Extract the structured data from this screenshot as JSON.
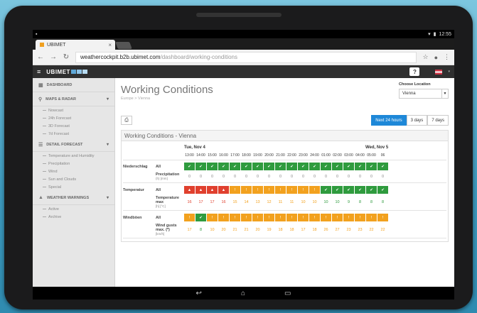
{
  "status_bar": {
    "left": "▪",
    "time": "12:55"
  },
  "browser": {
    "tab_title": "UBIMET",
    "url_host": "weathercockpit.b2b.ubimet.com",
    "url_path": "/dashboard/working-conditions"
  },
  "app": {
    "brand": "UBIMET",
    "help": "?"
  },
  "sidebar": {
    "dashboard": "DASHBOARD",
    "maps": "MAPS & RADAR",
    "maps_items": [
      "Nowcast",
      "24h Forecast",
      "3D Forecast",
      "7d Forecast"
    ],
    "detail": "DETAIL FORECAST",
    "detail_items": [
      "Temperature and Humidity",
      "Precipitation",
      "Wind",
      "Sun and Clouds",
      "Special"
    ],
    "warnings": "WEATHER WARNINGS",
    "warning_items": [
      "Active",
      "Archive"
    ]
  },
  "main": {
    "title": "Working Conditions",
    "breadcrumb": "Europe > Vienna",
    "location_label": "Choose Location",
    "location_value": "Vienna",
    "period_buttons": [
      "Next 24 hours",
      "3 days",
      "7 days"
    ],
    "panel_title": "Working Conditions - Vienna",
    "day1": "Tue, Nov 4",
    "day2": "Wed, Nov 5",
    "times": [
      "13:00",
      "14:00",
      "15:00",
      "16:00",
      "17:00",
      "18:00",
      "19:00",
      "20:00",
      "21:00",
      "22:00",
      "23:00",
      "24:00",
      "01:00",
      "02:00",
      "03:00",
      "04:00",
      "05:00",
      "06"
    ],
    "rows": [
      {
        "group": "Niederschlag",
        "sub": "All",
        "status": [
          "g",
          "g",
          "g",
          "g",
          "g",
          "g",
          "g",
          "g",
          "g",
          "g",
          "g",
          "g",
          "g",
          "g",
          "g",
          "g",
          "g",
          "g"
        ],
        "detail_label": "Precipitation",
        "detail_unit": "(h) [mm]",
        "values": [
          "0",
          "0",
          "0",
          "0",
          "0",
          "0",
          "0",
          "0",
          "0",
          "0",
          "0",
          "0",
          "0",
          "0",
          "0",
          "0",
          "0",
          "0"
        ]
      },
      {
        "group": "Temperatur",
        "sub": "All",
        "status": [
          "r",
          "r",
          "r",
          "r",
          "o",
          "o",
          "o",
          "o",
          "o",
          "o",
          "o",
          "o",
          "g",
          "g",
          "g",
          "g",
          "g",
          "g"
        ],
        "detail_label": "Temperature max",
        "detail_unit": "[h] [°C]",
        "values": [
          "16",
          "17",
          "17",
          "16",
          "15",
          "14",
          "13",
          "12",
          "11",
          "11",
          "10",
          "10",
          "10",
          "10",
          "9",
          "8",
          "8",
          "8"
        ]
      },
      {
        "group": "Windböen",
        "sub": "All",
        "status": [
          "o",
          "g",
          "o",
          "o",
          "o",
          "o",
          "o",
          "o",
          "o",
          "o",
          "o",
          "o",
          "o",
          "o",
          "o",
          "o",
          "o",
          "o"
        ],
        "detail_label": "Wind gusts max. (*)",
        "detail_unit": "[km/h]",
        "values": [
          "17",
          "8",
          "10",
          "20",
          "21",
          "21",
          "20",
          "19",
          "18",
          "18",
          "17",
          "18",
          "26",
          "27",
          "23",
          "23",
          "22",
          "22"
        ]
      }
    ]
  },
  "colors": {
    "green": "#2f9b3e",
    "orange": "#f2a11e",
    "red": "#e0402e",
    "accent": "#1e88d8"
  }
}
